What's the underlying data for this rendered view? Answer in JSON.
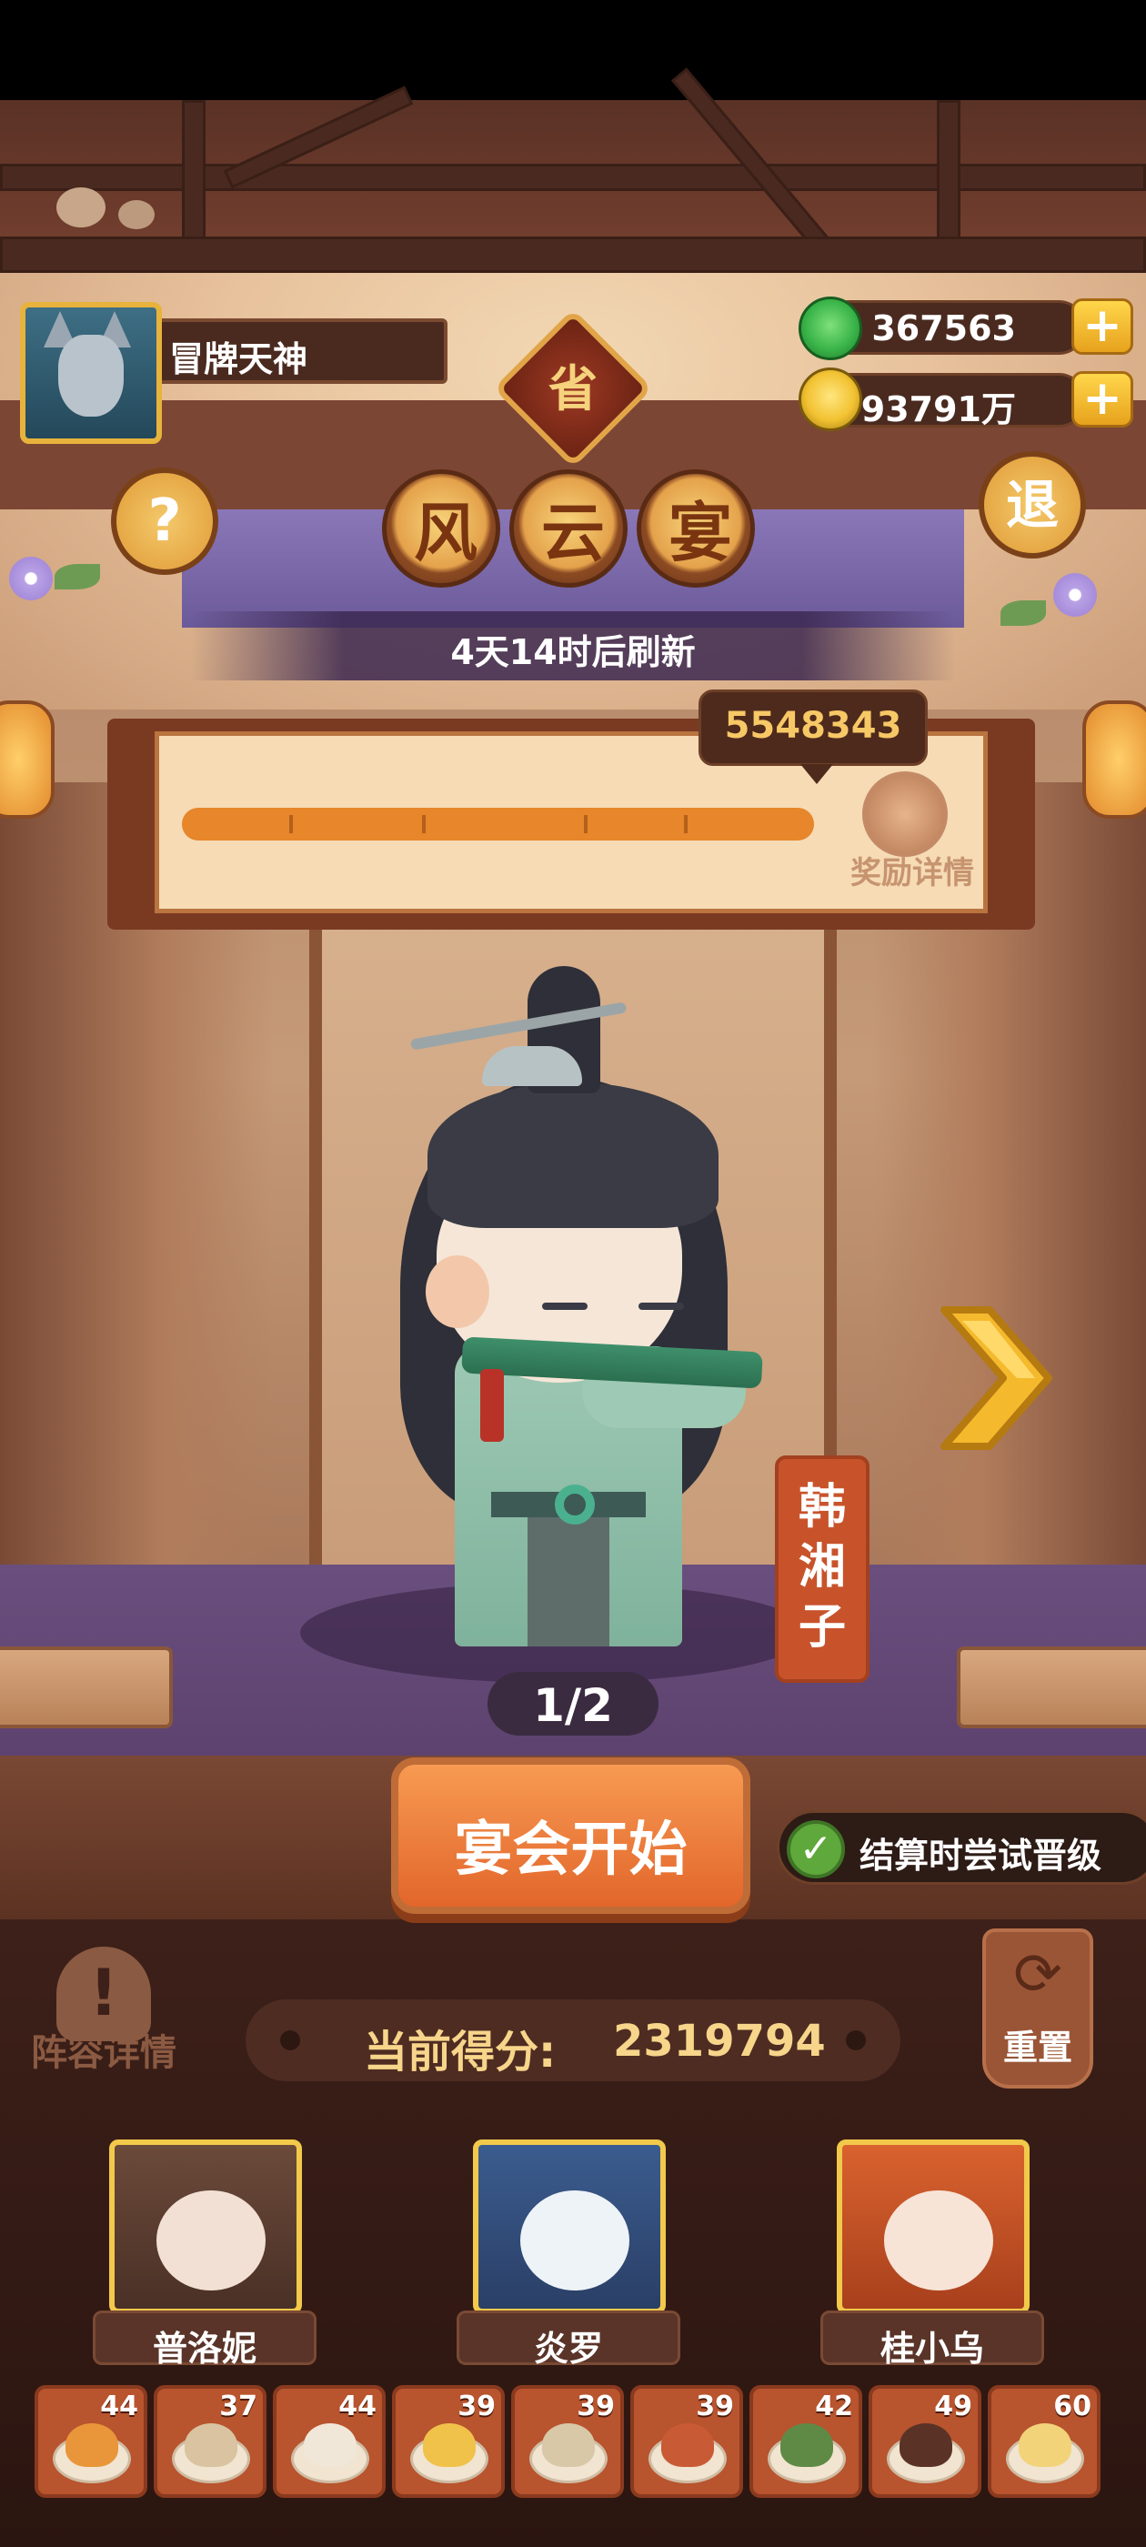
{
  "player": {
    "name": "冒牌天神",
    "avatar": "wolf-avatar"
  },
  "currencies": [
    {
      "name": "jade",
      "value": "367563",
      "icon": "green-jade-icon",
      "color": "#3bb54a"
    },
    {
      "name": "coins",
      "value": "93791万",
      "icon": "gold-coin-icon",
      "color": "#f2c232"
    }
  ],
  "header": {
    "badge": "省",
    "title_chars": [
      "风",
      "云",
      "宴"
    ],
    "refresh_text": "4天14时后刷新",
    "help_glyph": "?",
    "exit_glyph": "退"
  },
  "progress": {
    "target_score": "5548343",
    "fill_fraction": 1.0,
    "reward_label": "奖励详情"
  },
  "character": {
    "name": "韩湘子",
    "page": "1/2"
  },
  "actions": {
    "start_label": "宴会开始",
    "promote_label": "结算时尝试晋级",
    "promote_checked": true,
    "lineup_label": "阵容详情",
    "reset_label": "重置"
  },
  "score": {
    "label": "当前得分:",
    "value": "2319794"
  },
  "judges": [
    {
      "name": "普洛妮"
    },
    {
      "name": "炎罗"
    },
    {
      "name": "桂小乌"
    }
  ],
  "dishes": [
    {
      "count": "44",
      "icon": "fried-dish-icon"
    },
    {
      "count": "37",
      "icon": "soup-bowl-icon"
    },
    {
      "count": "44",
      "icon": "steamed-bun-icon"
    },
    {
      "count": "39",
      "icon": "omelette-icon"
    },
    {
      "count": "39",
      "icon": "scroll-portrait-icon"
    },
    {
      "count": "39",
      "icon": "skewer-icon"
    },
    {
      "count": "42",
      "icon": "bonsai-platter-icon"
    },
    {
      "count": "49",
      "icon": "cake-icon"
    },
    {
      "count": "60",
      "icon": "tofu-platter-icon"
    }
  ]
}
